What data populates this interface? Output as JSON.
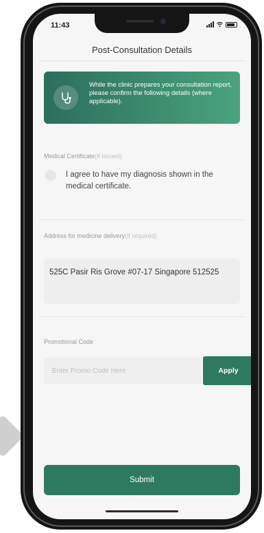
{
  "status_bar": {
    "time": "11:43"
  },
  "header": {
    "title": "Post-Consultation Details"
  },
  "banner": {
    "text": "While the clinic prepares your consultation report, please confirm the following details (where applicable)."
  },
  "medical_certificate": {
    "label": "Medical Certificate",
    "hint": "(If issued)",
    "consent_text": "I agree to have my diagnosis shown in the medical certificate.",
    "checked": false
  },
  "address": {
    "label": "Address for medicine delivery",
    "hint": "(If required)",
    "value": "525C Pasir Ris Grove #07-17 Singapore 512525"
  },
  "promo": {
    "label": "Promotional Code",
    "placeholder": "Enter Promo Code Here",
    "apply_label": "Apply"
  },
  "submit": {
    "label": "Submit"
  },
  "colors": {
    "accent": "#2d7a61",
    "banner_start": "#2c6e5c",
    "banner_end": "#4aa37f"
  },
  "icons": [
    "signal-icon",
    "wifi-icon",
    "battery-icon",
    "stethoscope-icon"
  ]
}
